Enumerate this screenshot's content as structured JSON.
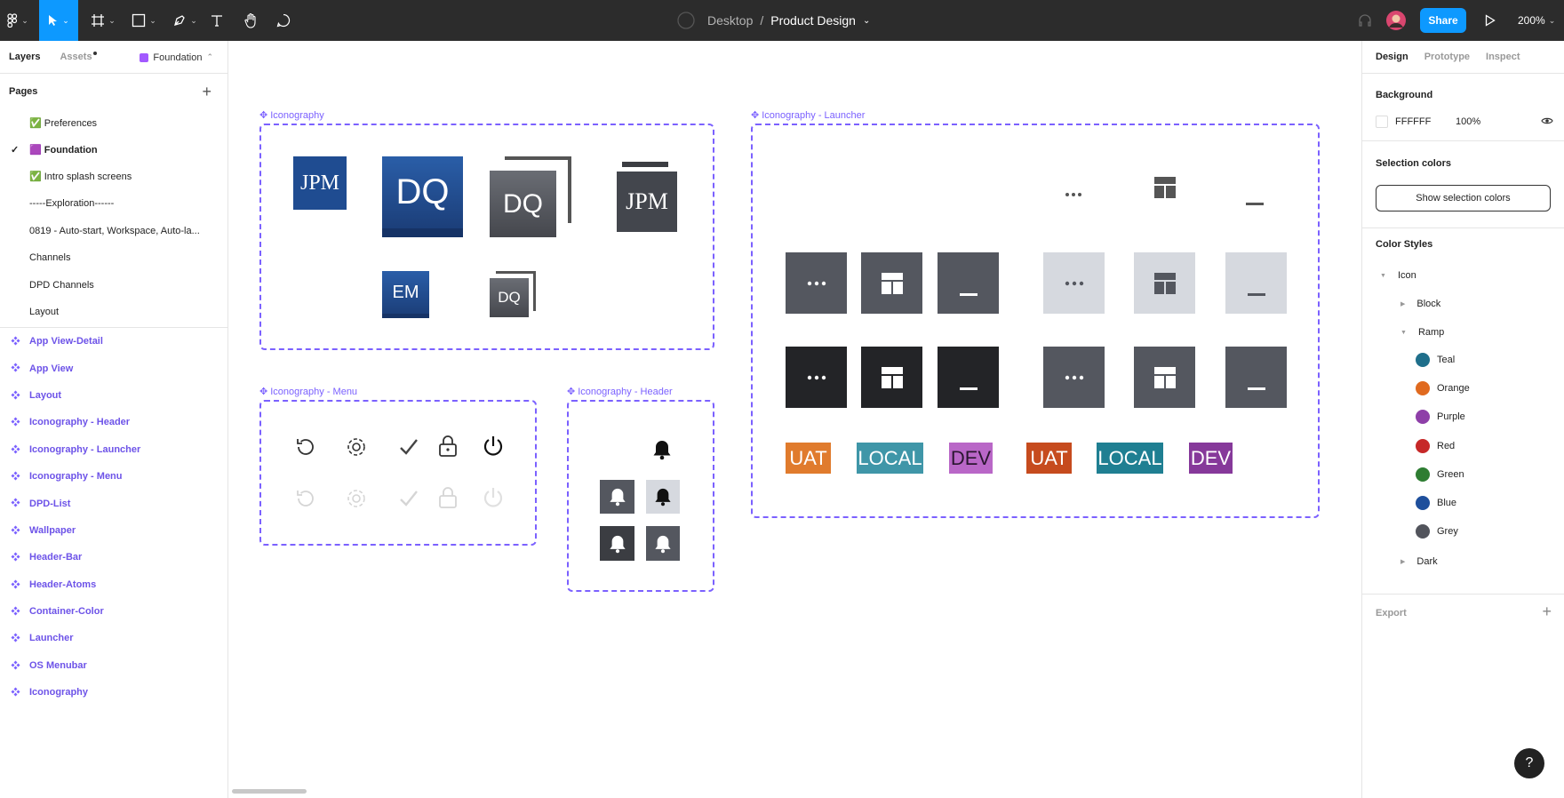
{
  "toolbar": {
    "breadcrumb_parent": "Desktop",
    "breadcrumb_sep": "/",
    "file_name": "Product Design",
    "share_label": "Share",
    "zoom": "200%"
  },
  "left_panel": {
    "tab_layers": "Layers",
    "tab_assets": "Assets",
    "page_selector": "Foundation",
    "pages_header": "Pages",
    "pages": [
      {
        "label": "✅ Preferences",
        "selected": false
      },
      {
        "label": "🟪 Foundation",
        "selected": true
      },
      {
        "label": "✅ Intro splash screens",
        "selected": false
      },
      {
        "label": "-----Exploration------",
        "selected": false
      },
      {
        "label": "0819 - Auto-start, Workspace, Auto-la...",
        "selected": false
      },
      {
        "label": "Channels",
        "selected": false
      },
      {
        "label": "DPD Channels",
        "selected": false
      },
      {
        "label": "Layout",
        "selected": false
      }
    ],
    "layers": [
      "App View-Detail",
      "App View",
      "Layout",
      "Iconography - Header",
      "Iconography - Launcher",
      "Iconography - Menu",
      "DPD-List",
      "Wallpaper",
      "Header-Bar",
      "Header-Atoms",
      "Container-Color",
      "Launcher",
      "OS Menubar",
      "Iconography"
    ]
  },
  "canvas": {
    "frames": {
      "iconography": "Iconography",
      "launcher": "Iconography - Launcher",
      "menu": "Iconography - Menu",
      "header": "Iconography - Header"
    },
    "logos": {
      "jpm": "JPM",
      "dq": "DQ",
      "em": "EM"
    },
    "env_badges": [
      {
        "label": "UAT",
        "color": "#e07b2d"
      },
      {
        "label": "LOCAL",
        "color": "#3f96a8"
      },
      {
        "label": "DEV",
        "color": "#b967c7"
      },
      {
        "label": "UAT",
        "color": "#c64b1e"
      },
      {
        "label": "LOCAL",
        "color": "#1f7f92"
      },
      {
        "label": "DEV",
        "color": "#86399a"
      }
    ]
  },
  "right_panel": {
    "tab_design": "Design",
    "tab_prototype": "Prototype",
    "tab_inspect": "Inspect",
    "background_title": "Background",
    "bg_hex": "FFFFFF",
    "bg_opacity": "100%",
    "selection_colors_title": "Selection colors",
    "show_selection_colors": "Show selection colors",
    "color_styles_title": "Color Styles",
    "styles": {
      "icon": "Icon",
      "block": "Block",
      "ramp": "Ramp",
      "dark": "Dark",
      "ramp_items": [
        {
          "name": "Teal",
          "color": "#1f6f8b"
        },
        {
          "name": "Orange",
          "color": "#e06a1f"
        },
        {
          "name": "Purple",
          "color": "#8e3fa8"
        },
        {
          "name": "Red",
          "color": "#c62828"
        },
        {
          "name": "Green",
          "color": "#2e7d32"
        },
        {
          "name": "Blue",
          "color": "#1e4f9c"
        },
        {
          "name": "Grey",
          "color": "#52545c"
        }
      ]
    },
    "export_title": "Export",
    "help": "?"
  }
}
